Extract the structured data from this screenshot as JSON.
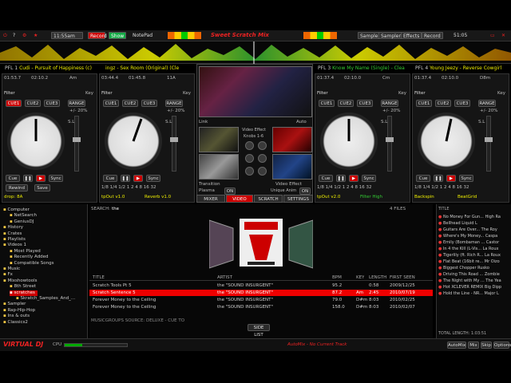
{
  "toolbar": {
    "time": "11:55am",
    "rec_label": "Record",
    "record_btn": "Record",
    "show_btn": "Show",
    "notepad": "NotePad",
    "title": "Sweet Scratch Mix",
    "sampler": "Sampler",
    "effects": "Effects",
    "zoom": "51:05",
    "record": "Record"
  },
  "decks": [
    {
      "label": "PFL 1",
      "title": "Cudi - Pursuit of Happiness (c)",
      "time1": "01:53.7",
      "time2": "02:10.2",
      "bpm": "Am",
      "pitch": "88.00",
      "key": "Key",
      "filter": "Filter",
      "pct": "+/- 20%",
      "loop": "drop: 8A",
      "mid": "01:53"
    },
    {
      "label": "",
      "title": "ingz - Sex Room (Original) (Cle",
      "time1": "03:44.4",
      "time2": "01:45.8",
      "bpm": "11A",
      "pitch": "88.00",
      "key": "Key",
      "filter": "Filter",
      "pct": "+/- 20%",
      "loop": "tpOut v1.0",
      "mid": "Reverb v1.0"
    },
    {
      "label": "PFL 3",
      "title": "Know My Name (Single) - Clea",
      "time1": "01:37.4",
      "time2": "02:10.0",
      "bpm": "Cm",
      "pitch": "88.00",
      "key": "Key",
      "filter": "Filter",
      "pct": "+/- 20%",
      "loop": "tpOut v2.0",
      "mid": "Filter High"
    },
    {
      "label": "PFL 4",
      "title": "Young Jeezy - Reverse Cowgirl",
      "time1": "01:37.4",
      "time2": "02:10.0",
      "bpm": "D8m",
      "pitch": "88.00",
      "key": "Key",
      "filter": "Filter",
      "pct": "+/- 20%",
      "loop": "Backspin",
      "mid": "BeatGrid"
    }
  ],
  "deck_buttons": {
    "cue1": "CUE1",
    "cue2": "CUE2",
    "cue3": "CUE3",
    "range": "RANGE",
    "cue": "Cue",
    "sync": "Sync",
    "rewind": "Rewind",
    "save": "Save",
    "on": "ON"
  },
  "mixer": {
    "link": "Link",
    "auto": "Auto",
    "video_effect": "Video Effect",
    "knobs": "Knobs 1-6",
    "transition": "Transition",
    "video_effect2": "Video Effect",
    "plasma": "Plasma",
    "on": "ON",
    "unique": "Unique Anim",
    "tabs": [
      "MIXER",
      "VIDEO",
      "SCRATCH",
      "SETTINGS"
    ]
  },
  "browser": {
    "search_label": "SEARCH:",
    "search_value": "the",
    "items": [
      {
        "label": "Computer",
        "indent": 0
      },
      {
        "label": "NetSearch",
        "indent": 1
      },
      {
        "label": "GeniusDJ",
        "indent": 1
      },
      {
        "label": "History",
        "indent": 0
      },
      {
        "label": "Crates",
        "indent": 0
      },
      {
        "label": "Playlists",
        "indent": 0
      },
      {
        "label": "Videos 1",
        "indent": 0
      },
      {
        "label": "Most Played",
        "indent": 1
      },
      {
        "label": "Recently Added",
        "indent": 1
      },
      {
        "label": "Compatible Songs",
        "indent": 1
      },
      {
        "label": "Music",
        "indent": 0
      },
      {
        "label": "Fx",
        "indent": 0
      },
      {
        "label": "Mixshowtools",
        "indent": 0
      },
      {
        "label": "8th Street",
        "indent": 1
      },
      {
        "label": "scratches",
        "indent": 1,
        "sel": true
      },
      {
        "label": "Skratch_Samples_And_...",
        "indent": 2
      },
      {
        "label": "Sampler",
        "indent": 0
      },
      {
        "label": "Rap-Hip-Hop",
        "indent": 0
      },
      {
        "label": "Ins & outs",
        "indent": 0
      },
      {
        "label": "Classics2",
        "indent": 0
      }
    ]
  },
  "files": {
    "count": "4 FILES",
    "headers": [
      "TITLE",
      "ARTIST",
      "BPM",
      "KEY",
      "LENGTH",
      "FIRST SEEN"
    ],
    "rows": [
      {
        "title": "Scratch Tools Pt 5",
        "artist": "the \"SOUND INSURGENT\"",
        "bpm": "95.2",
        "key": "",
        "length": "0:58",
        "seen": "2009/12/25",
        "sel": false
      },
      {
        "title": "Scratch Sentence 5",
        "artist": "the \"SOUND INSURGENT\"",
        "bpm": "87.2",
        "key": "Am",
        "length": "2:45",
        "seen": "2010/07/19",
        "sel": true
      },
      {
        "title": "Forever Money to the Ceiling",
        "artist": "the \"SOUND INSURGENT\"",
        "bpm": "79.0",
        "key": "D#m",
        "length": "8:03",
        "seen": "2010/02/25",
        "sel": false
      },
      {
        "title": "Forever Money to the Ceiling",
        "artist": "the \"SOUND INSURGENT\"",
        "bpm": "158.0",
        "key": "D#m",
        "length": "8:03",
        "seen": "2010/02/07",
        "sel": false
      }
    ],
    "footer": "MUSICGROUPS SOURCE: DELUXE - CUE TO",
    "side_list": "SIDE LIST"
  },
  "playlist": {
    "header": "TITLE",
    "items": [
      "No Money For Gun... High Ra",
      "Bellhead Liquid L",
      "Guitars Are Over... The Roy",
      "Where's My Money... Caspa",
      "Emily (Bombaman ... Castor",
      "In 4 the Kill (L-Vis... La Roux",
      "Tigerlily (ft. Rich R... La Roux",
      "Flat Beat (16bit re... Mr Oizo",
      "Biggest Chopper Rusko",
      "Driving This Road ... Zombie",
      "The Night with My ... The Yea",
      "Hot XCLEVER REMIX Big Dipp",
      "Hold the Line - NR... Major L"
    ],
    "total": "TOTAL LENGTH: 1:03:51"
  },
  "bottom": {
    "logo": "VIRTUAL DJ",
    "cpu": "CPU",
    "automix": "AutoMix - No Current Track",
    "automix_btn": "AutoMix",
    "mix": "Mix",
    "skip": "Skip",
    "options": "Options"
  },
  "colors": {
    "accent": "#cc0000",
    "deck_title": "#eeee00",
    "green": "#11aa44"
  }
}
